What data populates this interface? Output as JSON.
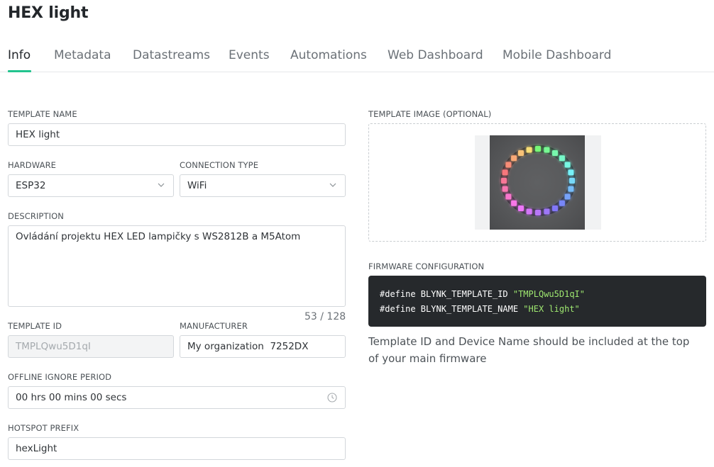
{
  "page": {
    "title": "HEX light"
  },
  "tabs": [
    {
      "label": "Info",
      "active": true
    },
    {
      "label": "Metadata"
    },
    {
      "label": "Datastreams"
    },
    {
      "label": "Events"
    },
    {
      "label": "Automations"
    },
    {
      "label": "Web Dashboard"
    },
    {
      "label": "Mobile Dashboard"
    }
  ],
  "form": {
    "template_name": {
      "label": "TEMPLATE NAME",
      "value": "HEX light"
    },
    "hardware": {
      "label": "HARDWARE",
      "value": "ESP32"
    },
    "connection_type": {
      "label": "CONNECTION TYPE",
      "value": "WiFi"
    },
    "description": {
      "label": "DESCRIPTION",
      "value": "Ovládání projektu HEX LED lampičky s WS2812B a M5Atom",
      "counter": "53 / 128"
    },
    "template_id": {
      "label": "TEMPLATE ID",
      "value": "TMPLQwu5D1qI"
    },
    "manufacturer": {
      "label": "MANUFACTURER",
      "value": "My organization  7252DX"
    },
    "offline_ignore": {
      "label": "OFFLINE IGNORE PERIOD",
      "value": "00 hrs 00 mins 00 secs"
    },
    "hotspot_prefix": {
      "label": "HOTSPOT PREFIX",
      "value": "hexLight"
    }
  },
  "template_image": {
    "label": "TEMPLATE IMAGE (OPTIONAL)"
  },
  "firmware": {
    "label": "FIRMWARE CONFIGURATION",
    "line1_kw": "#define BLYNK_TEMPLATE_ID ",
    "line1_val": "\"TMPLQwu5D1qI\"",
    "line2_kw": "#define BLYNK_TEMPLATE_NAME ",
    "line2_val": "\"HEX light\"",
    "note": "Template ID and Device Name should be included at the top of your main firmware"
  },
  "colors": {
    "accent": "#23c48e",
    "code_bg": "#26292c",
    "code_string": "#9fe870"
  },
  "icons": {
    "select": "chevron-down-icon",
    "time": "clock-icon"
  }
}
